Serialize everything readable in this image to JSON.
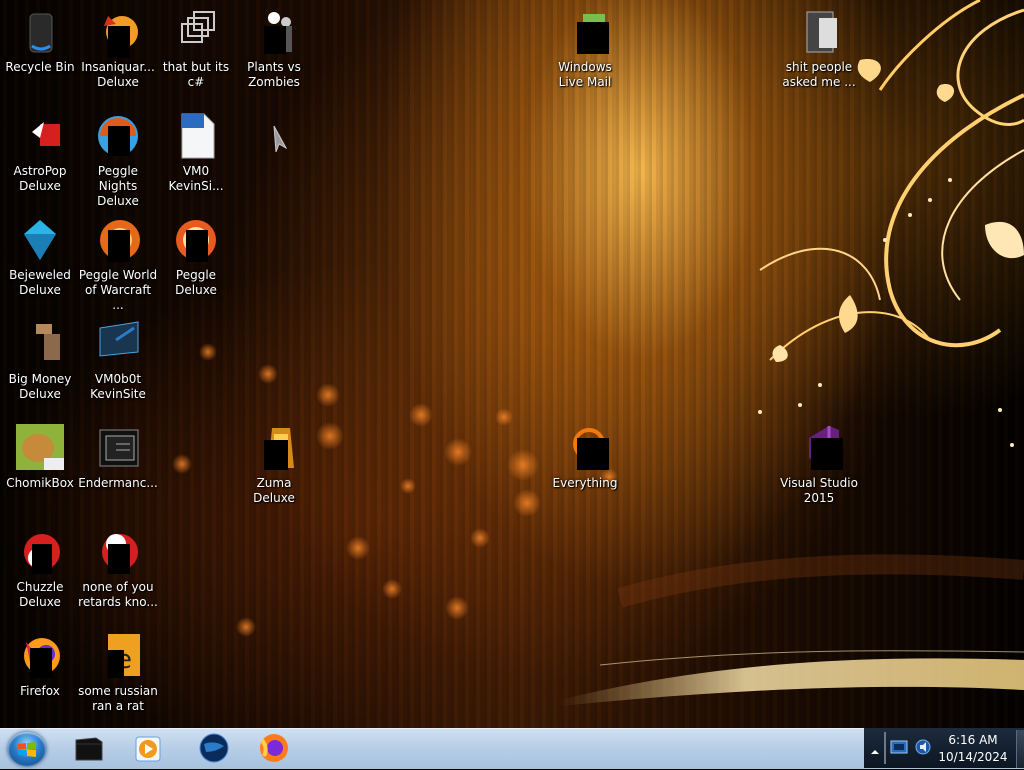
{
  "desktop": {
    "icons": [
      {
        "id": "recycle_bin",
        "label": "Recycle Bin"
      },
      {
        "id": "insaniquarium",
        "label": "Insaniquar... Deluxe"
      },
      {
        "id": "that_but",
        "label": "that but its c#"
      },
      {
        "id": "pvz",
        "label": "Plants vs Zombies"
      },
      {
        "id": "wlm",
        "label": "Windows Live Mail"
      },
      {
        "id": "shit_people",
        "label": "shit people asked me ..."
      },
      {
        "id": "astropop",
        "label": "AstroPop Deluxe"
      },
      {
        "id": "peggle_nights",
        "label": "Peggle Nights Deluxe"
      },
      {
        "id": "vm0",
        "label": "VM0 KevinSi..."
      },
      {
        "id": "bejeweled",
        "label": "Bejeweled Deluxe"
      },
      {
        "id": "peggle_wow",
        "label": "Peggle World of Warcraft ..."
      },
      {
        "id": "peggle_deluxe",
        "label": "Peggle Deluxe"
      },
      {
        "id": "big_money",
        "label": "Big Money Deluxe"
      },
      {
        "id": "vm0b0t",
        "label": "VM0b0t KevinSite"
      },
      {
        "id": "chomikbox",
        "label": "ChomikBox"
      },
      {
        "id": "endermanch",
        "label": "Endermanc..."
      },
      {
        "id": "zuma",
        "label": "Zuma Deluxe"
      },
      {
        "id": "everything",
        "label": "Everything"
      },
      {
        "id": "vs2015",
        "label": "Visual Studio 2015"
      },
      {
        "id": "chuzzle",
        "label": "Chuzzle Deluxe"
      },
      {
        "id": "none_of_you",
        "label": "none of you retards kno..."
      },
      {
        "id": "firefox",
        "label": "Firefox"
      },
      {
        "id": "russian_rat",
        "label": "some russian ran a rat"
      }
    ]
  },
  "taskbar": {
    "pinned": [
      "file-explorer-icon",
      "media-player-icon",
      "globe-icon",
      "firefox-icon"
    ]
  },
  "tray": {
    "time": "6:16 AM",
    "date": "10/14/2024"
  },
  "colors": {
    "taskbar": "#b6cde6",
    "tray": "#0c1622",
    "accent": "#ffb54a"
  }
}
